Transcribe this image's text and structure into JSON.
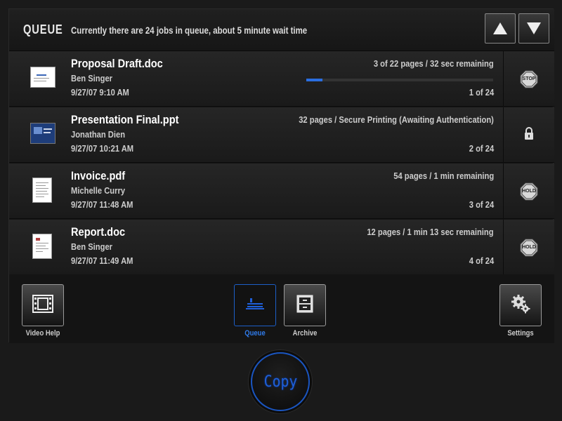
{
  "header": {
    "title": "QUEUE",
    "status": "Currently there are 24 jobs in queue, about 5 minute wait time",
    "scroll_up_icon": "arrow-up-icon",
    "scroll_down_icon": "arrow-down-icon"
  },
  "jobs": [
    {
      "name": "Proposal Draft.doc",
      "owner": "Ben Singer",
      "date": "9/27/07 9:10 AM",
      "detail": "3 of 22 pages / 32 sec remaining",
      "position": "1 of 24",
      "progress": 0.086,
      "action": "STOP",
      "action_icon": "stop-sign-icon"
    },
    {
      "name": "Presentation Final.ppt",
      "owner": "Jonathan Dien",
      "date": "9/27/07 10:21 AM",
      "detail": "32 pages / Secure Printing (Awaiting Authentication)",
      "position": "2 of 24",
      "action_icon": "lock-icon"
    },
    {
      "name": "Invoice.pdf",
      "owner": "Michelle Curry",
      "date": "9/27/07 11:48 AM",
      "detail": "54 pages / 1 min remaining",
      "position": "3 of 24",
      "action": "HOLD",
      "action_icon": "hold-sign-icon"
    },
    {
      "name": "Report.doc",
      "owner": "Ben Singer",
      "date": "9/27/07 11:49 AM",
      "detail": "12 pages / 1 min 13 sec remaining",
      "position": "4 of 24",
      "action": "HOLD",
      "action_icon": "hold-sign-icon"
    }
  ],
  "toolbar": {
    "video_help_label": "Video Help",
    "queue_label": "Queue",
    "archive_label": "Archive",
    "settings_label": "Settings",
    "active_tab": "Queue"
  },
  "copy_button": {
    "label": "Copy"
  },
  "colors": {
    "accent_blue": "#1f5fd8",
    "background": "#1a1a1a"
  }
}
